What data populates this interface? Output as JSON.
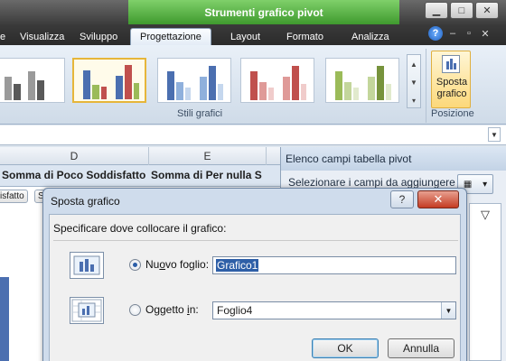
{
  "title_bar": {
    "tools_title": "Strumenti grafico pivot",
    "window_buttons": [
      "▁",
      "□",
      "✕"
    ]
  },
  "ribbon_tabs": {
    "partial": "e",
    "items": [
      "Visualizza",
      "Sviluppo",
      "Progettazione",
      "Layout",
      "Formato",
      "Analizza"
    ],
    "active": "Progettazione"
  },
  "ribbon": {
    "group_styles_label": "Stili grafici",
    "group_position_label": "Posizione",
    "sposta_label_1": "Sposta",
    "sposta_label_2": "grafico"
  },
  "sheet": {
    "col_d": "D",
    "col_e": "E",
    "header_col_d": "Somma di Poco Soddisfatto",
    "header_col_e": "Somma di Per nulla S",
    "chip_1": "isfatto",
    "chip_2": "S"
  },
  "pivot_pane": {
    "title": "Elenco campi tabella pivot",
    "caption": "Selezionare i campi da aggiungere al"
  },
  "dialog": {
    "title": "Sposta grafico",
    "help": "?",
    "close": "✕",
    "instruction": "Specificare dove collocare il grafico:",
    "option_new_sheet_pre": "Nu",
    "option_new_sheet_key": "o",
    "option_new_sheet_post": "vo foglio:",
    "new_sheet_value": "Grafico1",
    "option_object_pre": "Oggetto ",
    "option_object_key": "i",
    "option_object_post": "n:",
    "object_value": "Foglio4",
    "ok": "OK",
    "cancel": "Annulla"
  },
  "colors": {
    "accent_green": "#4faf3a",
    "selection_blue": "#2e5fa7",
    "bar_blue": "#4b6fb0",
    "bar_red": "#c0504d",
    "bar_green": "#9bbb59",
    "bar_gray": "#7f7f7f"
  }
}
